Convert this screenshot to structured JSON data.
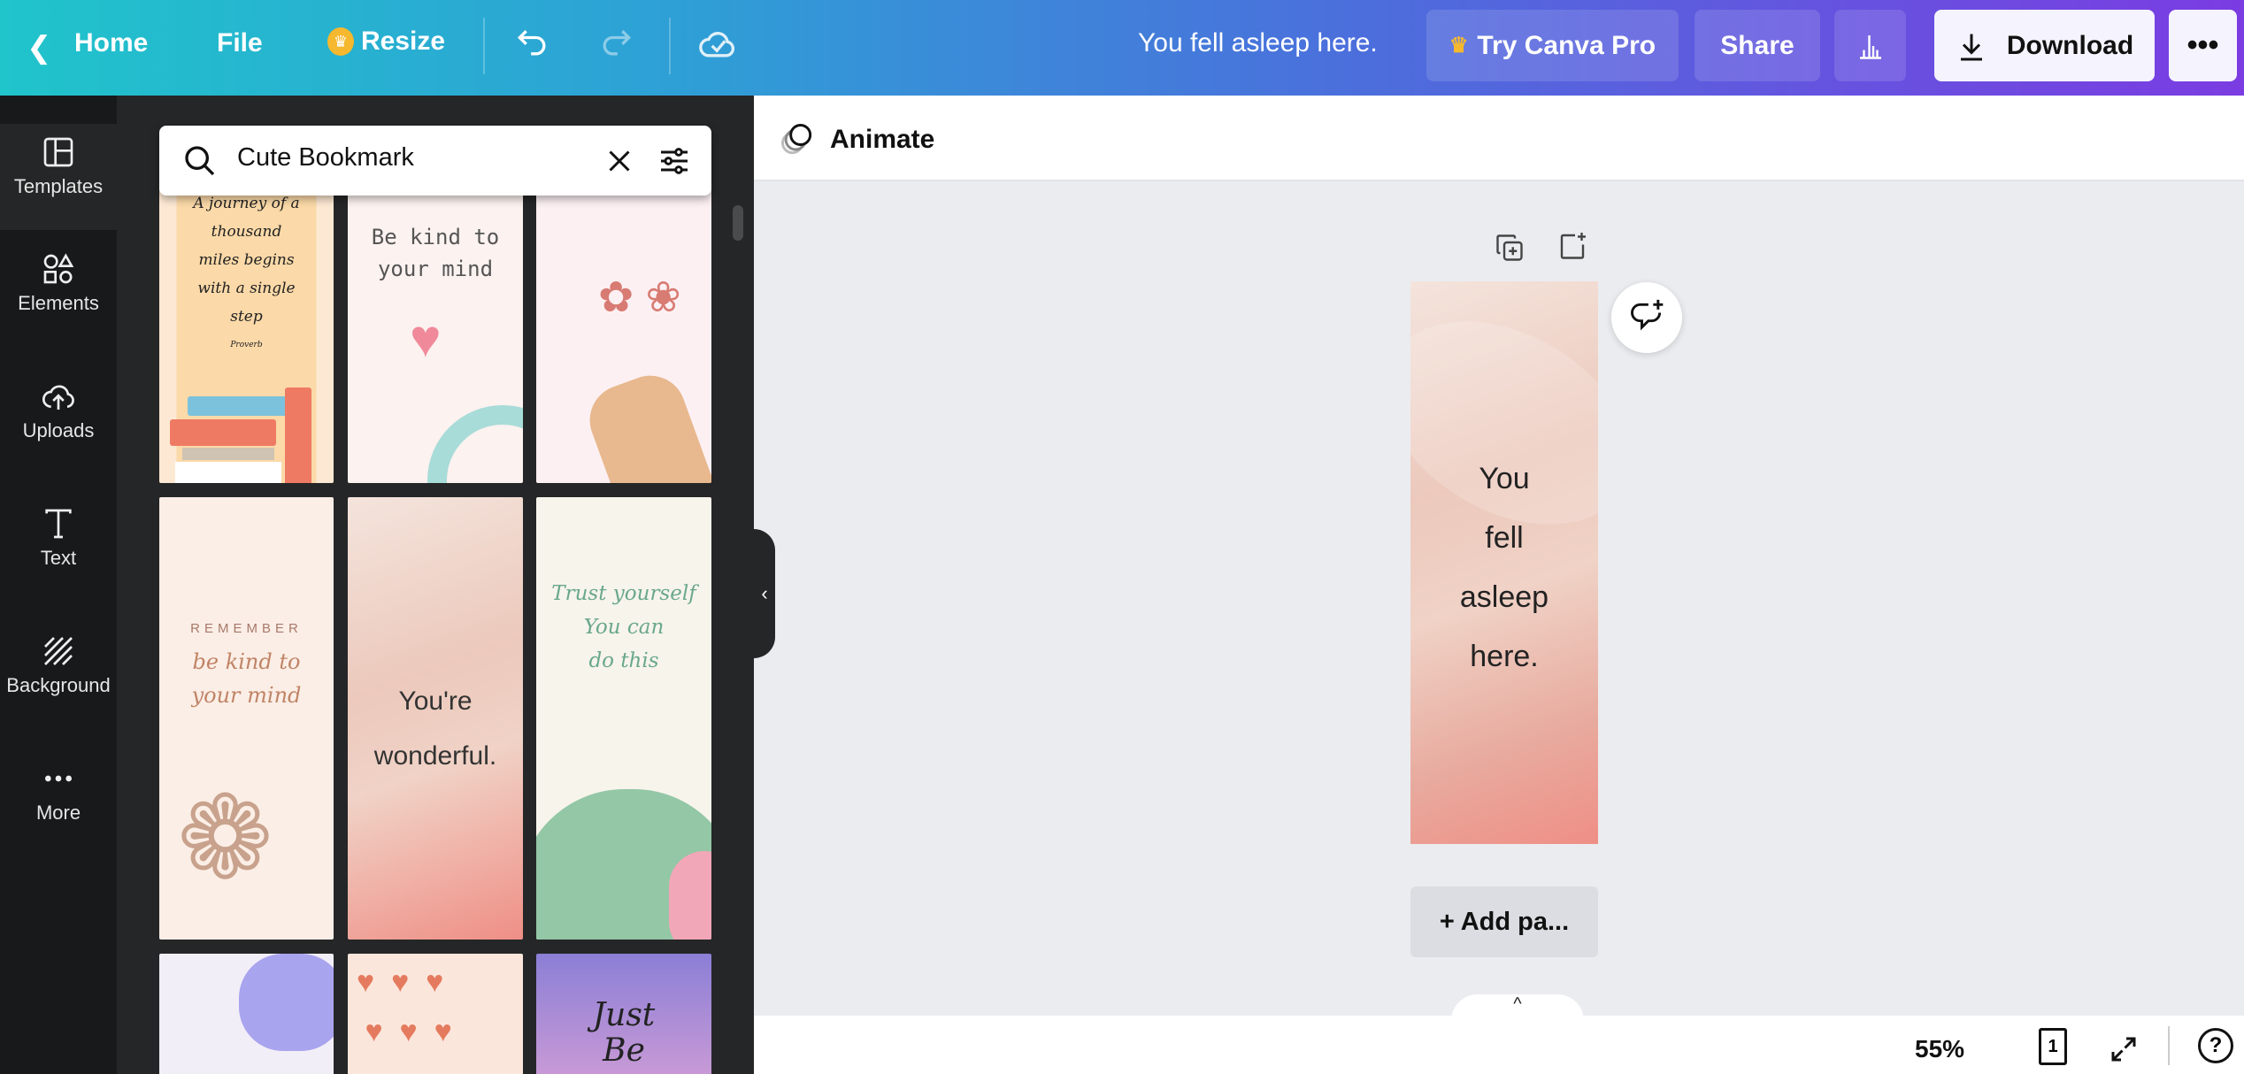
{
  "topbar": {
    "home": "Home",
    "file": "File",
    "resize": "Resize",
    "design_title": "You fell asleep here.",
    "try_pro": "Try Canva Pro",
    "share": "Share",
    "download": "Download"
  },
  "rail": {
    "items": [
      {
        "label": "Templates",
        "icon": "templates-icon"
      },
      {
        "label": "Elements",
        "icon": "elements-icon"
      },
      {
        "label": "Uploads",
        "icon": "uploads-icon"
      },
      {
        "label": "Text",
        "icon": "text-icon"
      },
      {
        "label": "Background",
        "icon": "background-icon"
      },
      {
        "label": "More",
        "icon": "more-icon"
      }
    ]
  },
  "search": {
    "value": "Cute Bookmark"
  },
  "templates": {
    "t1": [
      "A journey of a",
      "thousand",
      "miles begins",
      "with a single",
      "step",
      "Proverb"
    ],
    "t2": [
      "Be kind to",
      "your mind"
    ],
    "t4": [
      "REMEMBER",
      "be kind to",
      "your mind"
    ],
    "t5": [
      "You're",
      "wonderful."
    ],
    "t6": [
      "Trust yourself",
      "You can",
      "do this"
    ],
    "t9": [
      "Just",
      "Be"
    ]
  },
  "editor": {
    "animate": "Animate",
    "page_text": [
      "You",
      "fell",
      "asleep",
      "here."
    ],
    "add_page": "+ Add pa..."
  },
  "bottombar": {
    "zoom": "55%",
    "page_count": "1",
    "help": "?"
  },
  "colors": {
    "gradient_start": "#20c4cb",
    "gradient_end": "#7b3ce2",
    "crown": "#f5b82e"
  }
}
